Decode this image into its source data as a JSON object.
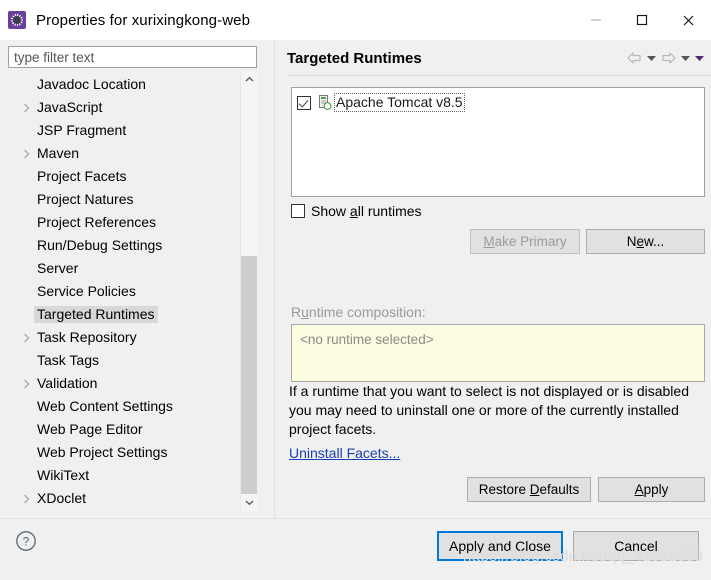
{
  "window": {
    "title": "Properties for xurixingkong-web",
    "icon": "eclipse-properties-icon",
    "minimize_label": "—",
    "maximize_label": "□",
    "close_label": "✕"
  },
  "sidebar": {
    "filter": {
      "value": "",
      "placeholder": "type filter text"
    },
    "items": [
      {
        "label": "Javadoc Location",
        "expandable": false,
        "selected": false
      },
      {
        "label": "JavaScript",
        "expandable": true,
        "selected": false
      },
      {
        "label": "JSP Fragment",
        "expandable": false,
        "selected": false
      },
      {
        "label": "Maven",
        "expandable": true,
        "selected": false
      },
      {
        "label": "Project Facets",
        "expandable": false,
        "selected": false
      },
      {
        "label": "Project Natures",
        "expandable": false,
        "selected": false
      },
      {
        "label": "Project References",
        "expandable": false,
        "selected": false
      },
      {
        "label": "Run/Debug Settings",
        "expandable": false,
        "selected": false
      },
      {
        "label": "Server",
        "expandable": false,
        "selected": false
      },
      {
        "label": "Service Policies",
        "expandable": false,
        "selected": false
      },
      {
        "label": "Targeted Runtimes",
        "expandable": false,
        "selected": true
      },
      {
        "label": "Task Repository",
        "expandable": true,
        "selected": false
      },
      {
        "label": "Task Tags",
        "expandable": false,
        "selected": false
      },
      {
        "label": "Validation",
        "expandable": true,
        "selected": false
      },
      {
        "label": "Web Content Settings",
        "expandable": false,
        "selected": false
      },
      {
        "label": "Web Page Editor",
        "expandable": false,
        "selected": false
      },
      {
        "label": "Web Project Settings",
        "expandable": false,
        "selected": false
      },
      {
        "label": "WikiText",
        "expandable": false,
        "selected": false
      },
      {
        "label": "XDoclet",
        "expandable": true,
        "selected": false
      }
    ],
    "scrollbar": {
      "up_icon": "chevron-up-icon",
      "down_icon": "chevron-down-icon"
    }
  },
  "page": {
    "title": "Targeted Runtimes",
    "nav": {
      "back_icon": "back-arrow-icon",
      "back_menu_icon": "chevron-down-icon",
      "forward_icon": "forward-arrow-icon",
      "forward_menu_icon": "chevron-down-icon",
      "view_menu_icon": "chevron-down-icon"
    },
    "runtimes": [
      {
        "label": "Apache Tomcat v8.5",
        "checked": true,
        "icon": "server-icon",
        "focused": true
      }
    ],
    "show_all": {
      "label": "Show all runtimes",
      "checked": false
    },
    "make_primary_button": {
      "label": "Make Primary",
      "enabled": false
    },
    "new_button": {
      "label": "New...",
      "enabled": true
    },
    "composition_label": "Runtime composition:",
    "composition_value": "<no runtime selected>",
    "note": "If a runtime that you want to select is not displayed or is disabled you may need to uninstall one or more of the currently installed project facets.",
    "uninstall_link": "Uninstall Facets...",
    "restore_defaults_button": "Restore Defaults",
    "apply_button": "Apply"
  },
  "footer": {
    "help_icon": "help-icon",
    "apply_and_close_button": "Apply and Close",
    "cancel_button": "Cancel"
  },
  "watermark": "https://blog.csdn.net/qq_41512359",
  "colors": {
    "accent": "#0078d7",
    "link": "#1a3fb0",
    "selection": "#d8d8d8",
    "composition_bg": "#fcfce0",
    "dialog_bg": "#f0f0f0"
  }
}
